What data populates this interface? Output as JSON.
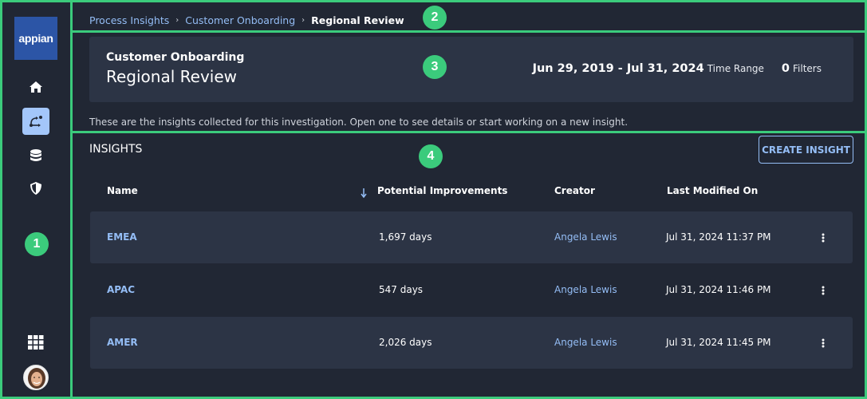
{
  "sidebar": {
    "logo_text": "appian",
    "nav_items": [
      {
        "icon": "home-icon",
        "active": false
      },
      {
        "icon": "process-flow-icon",
        "active": true
      },
      {
        "icon": "database-icon",
        "active": false
      },
      {
        "icon": "shield-icon",
        "active": false
      }
    ],
    "apps_icon": "grid-apps-icon",
    "avatar": "user-avatar"
  },
  "breadcrumb": {
    "items": [
      "Process Insights",
      "Customer Onboarding"
    ],
    "current": "Regional Review",
    "separator": "›"
  },
  "header": {
    "subtitle": "Customer Onboarding",
    "title": "Regional Review",
    "date_range": "Jun 29, 2019 - Jul 31, 2024",
    "time_range_label": "Time Range",
    "filters_count": "0",
    "filters_label": "Filters"
  },
  "description": "These are the insights collected for this investigation. Open one to see details or start working on a new insight.",
  "insights": {
    "section_title": "INSIGHTS",
    "create_button": "CREATE INSIGHT",
    "columns": {
      "name": "Name",
      "improvements": "Potential Improvements",
      "creator": "Creator",
      "modified": "Last Modified On"
    },
    "sort_indicator": "↓",
    "rows": [
      {
        "name": "EMEA",
        "improvements": "1,697 days",
        "creator": "Angela Lewis",
        "modified": "Jul 31, 2024 11:37 PM"
      },
      {
        "name": "APAC",
        "improvements": "547 days",
        "creator": "Angela Lewis",
        "modified": "Jul 31, 2024 11:46 PM"
      },
      {
        "name": "AMER",
        "improvements": "2,026 days",
        "creator": "Angela Lewis",
        "modified": "Jul 31, 2024 11:45 PM"
      }
    ]
  },
  "annotations": [
    "1",
    "2",
    "3",
    "4"
  ],
  "colors": {
    "background": "#212734",
    "card": "#2c3445",
    "link": "#94bdf5",
    "logo": "#2c55a6",
    "active_nav": "#a3c6fa",
    "annotation": "#3bcb7c"
  }
}
